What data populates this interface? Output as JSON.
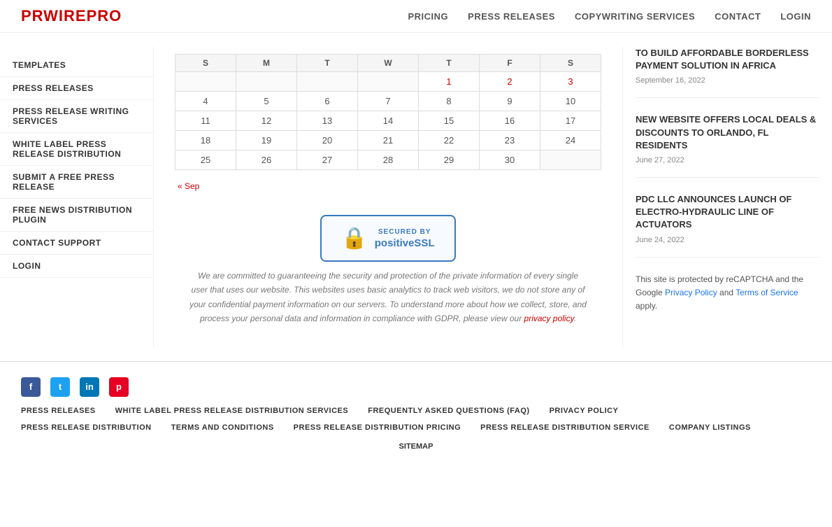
{
  "header": {
    "logo": "PRWIREPRO",
    "nav": [
      {
        "label": "PRICING",
        "href": "#"
      },
      {
        "label": "PRESS RELEASES",
        "href": "#"
      },
      {
        "label": "COPYWRITING SERVICES",
        "href": "#"
      },
      {
        "label": "CONTACT",
        "href": "#",
        "active": true
      },
      {
        "label": "LOGIN",
        "href": "#"
      }
    ]
  },
  "sidebar": {
    "items": [
      {
        "label": "TEMPLATES"
      },
      {
        "label": "PRESS RELEASES"
      },
      {
        "label": "PRESS RELEASE WRITING SERVICES"
      },
      {
        "label": "WHITE LABEL PRESS RELEASE DISTRIBUTION"
      },
      {
        "label": "SUBMIT A FREE PRESS RELEASE"
      },
      {
        "label": "FREE NEWS DISTRIBUTION PLUGIN"
      },
      {
        "label": "CONTACT SUPPORT"
      },
      {
        "label": "LOGIN"
      }
    ]
  },
  "calendar": {
    "days_header": [
      "S",
      "M",
      "T",
      "W",
      "T",
      "F",
      "S"
    ],
    "weeks": [
      [
        "",
        "",
        "",
        "",
        "1",
        "2",
        "3"
      ],
      [
        "4",
        "5",
        "6",
        "7",
        "8",
        "9",
        "10"
      ],
      [
        "11",
        "12",
        "13",
        "14",
        "15",
        "16",
        "17"
      ],
      [
        "18",
        "19",
        "20",
        "21",
        "22",
        "23",
        "24"
      ],
      [
        "25",
        "26",
        "27",
        "28",
        "29",
        "30",
        ""
      ]
    ],
    "prev_nav": "« Sep"
  },
  "ssl": {
    "secured_by": "SECURED BY",
    "ssl_name": "positiveSSL",
    "lock_symbol": "🔒"
  },
  "security_text": "We are committed to guaranteeing the security and protection of the private information of every single user that uses our website. This websites uses basic analytics to track web visitors, we do not store any of your confidential payment information on our servers. To understand more about how we collect, store, and process your personal data and information in compliance with GDPR, please view our privacy policy.",
  "privacy_policy_link": "privacy policy",
  "news": [
    {
      "title": "TO BUILD AFFORDABLE BORDERLESS PAYMENT SOLUTION IN AFRICA",
      "date": "September 16, 2022"
    },
    {
      "title": "NEW WEBSITE OFFERS LOCAL DEALS & DISCOUNTS TO ORLANDO, FL RESIDENTS",
      "date": "June 27, 2022"
    },
    {
      "title": "PDC LLC ANNOUNCES LAUNCH OF ELECTRO-HYDRAULIC LINE OF ACTUATORS",
      "date": "June 24, 2022"
    }
  ],
  "recaptcha_note": "This site is protected by reCAPTCHA and the Google Privacy Policy and Terms of Service apply.",
  "footer": {
    "social": [
      {
        "name": "facebook",
        "symbol": "f"
      },
      {
        "name": "twitter",
        "symbol": "t"
      },
      {
        "name": "linkedin",
        "symbol": "in"
      },
      {
        "name": "pinterest",
        "symbol": "p"
      }
    ],
    "links_row1": [
      {
        "label": "PRESS RELEASES"
      },
      {
        "label": "WHITE LABEL PRESS RELEASE DISTRIBUTION SERVICES"
      },
      {
        "label": "FREQUENTLY ASKED QUESTIONS (FAQ)"
      },
      {
        "label": "PRIVACY POLICY"
      }
    ],
    "links_row2": [
      {
        "label": "PRESS RELEASE DISTRIBUTION"
      },
      {
        "label": "TERMS AND CONDITIONS"
      },
      {
        "label": "PRESS RELEASE DISTRIBUTION PRICING"
      },
      {
        "label": "PRESS RELEASE DISTRIBUTION SERVICE"
      },
      {
        "label": "COMPANY LISTINGS"
      }
    ],
    "sitemap": "SITEMAP"
  }
}
